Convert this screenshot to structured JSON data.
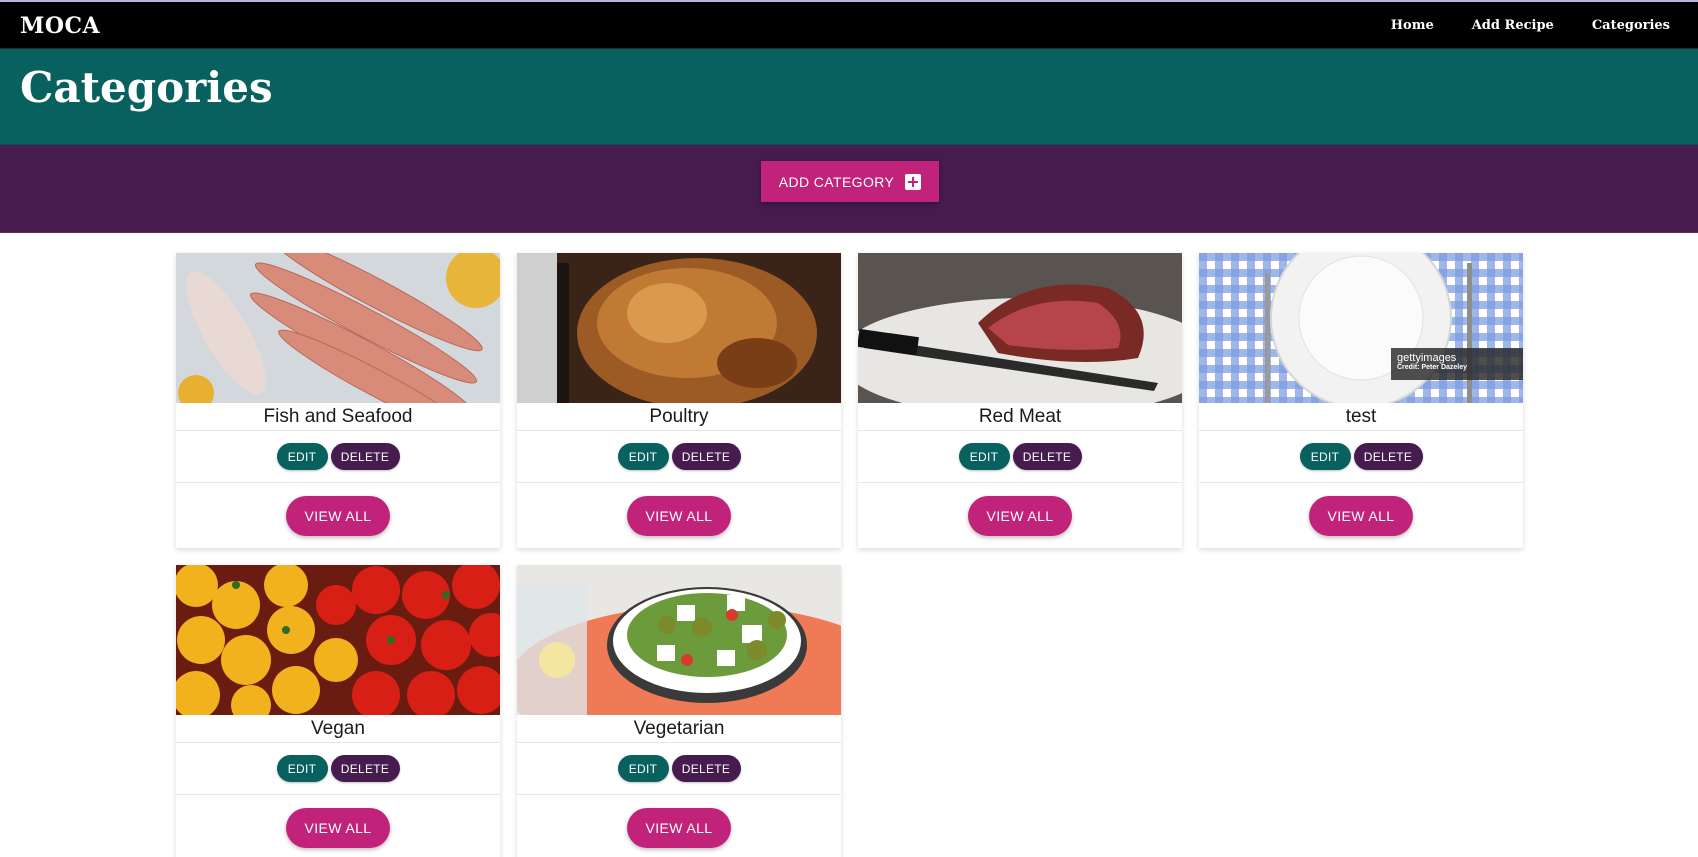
{
  "nav": {
    "brand": "MOCA",
    "links": [
      {
        "label": "Home"
      },
      {
        "label": "Add Recipe"
      },
      {
        "label": "Categories"
      }
    ]
  },
  "header": {
    "title": "Categories"
  },
  "actions": {
    "add_category_label": "ADD CATEGORY",
    "add_icon": "plus-square-icon"
  },
  "cards": [
    {
      "title": "Fish and Seafood",
      "edit_label": "EDIT",
      "delete_label": "DELETE",
      "view_label": "VIEW ALL",
      "image": "fish-image"
    },
    {
      "title": "Poultry",
      "edit_label": "EDIT",
      "delete_label": "DELETE",
      "view_label": "VIEW ALL",
      "image": "roast-chicken-image"
    },
    {
      "title": "Red Meat",
      "edit_label": "EDIT",
      "delete_label": "DELETE",
      "view_label": "VIEW ALL",
      "image": "steak-image"
    },
    {
      "title": "test",
      "edit_label": "EDIT",
      "delete_label": "DELETE",
      "view_label": "VIEW ALL",
      "image": "plate-image",
      "watermark": [
        "gettyimages",
        "Credit: Peter Dazeley"
      ]
    },
    {
      "title": "Vegan",
      "edit_label": "EDIT",
      "delete_label": "DELETE",
      "view_label": "VIEW ALL",
      "image": "peppers-image"
    },
    {
      "title": "Vegetarian",
      "edit_label": "EDIT",
      "delete_label": "DELETE",
      "view_label": "VIEW ALL",
      "image": "greek-salad-image"
    }
  ],
  "colors": {
    "navbar": "#000000",
    "header": "#09615f",
    "action_bar": "#461b4e",
    "accent": "#c2237a",
    "edit": "#09615f",
    "delete": "#461b4e"
  }
}
